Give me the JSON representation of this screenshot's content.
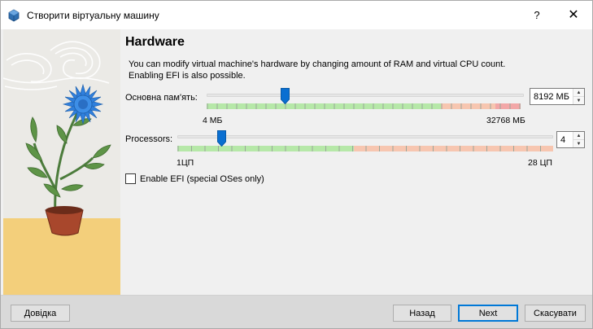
{
  "window": {
    "title": "Створити віртуальну машину",
    "help_label": "?",
    "close_label": "✕",
    "app_icon": "virtualbox-icon"
  },
  "page": {
    "heading": "Hardware",
    "description": "You can modify virtual machine's hardware by changing amount of RAM and virtual CPU count. Enabling EFI is also possible."
  },
  "memory": {
    "label": "Основна пам'ять:",
    "value": "8192 МБ",
    "min_label": "4 МБ",
    "max_label": "32768 МБ",
    "min": 4,
    "max": 32768,
    "current": 8192
  },
  "processors": {
    "label": "Processors:",
    "value": "4",
    "min_label": "1ЦП",
    "max_label": "28 ЦП",
    "min": 1,
    "max": 28,
    "current": 4
  },
  "efi": {
    "label": "Enable EFI (special OSes only)",
    "checked": false
  },
  "buttons": {
    "help": "Довідка",
    "back": "Назад",
    "next": "Next",
    "cancel": "Скасувати"
  },
  "colors": {
    "zone_green": "#b6e8a8",
    "zone_orange": "#f7c6b0",
    "zone_red": "#f2a7a7",
    "thumb_blue": "#0a6fd1"
  }
}
